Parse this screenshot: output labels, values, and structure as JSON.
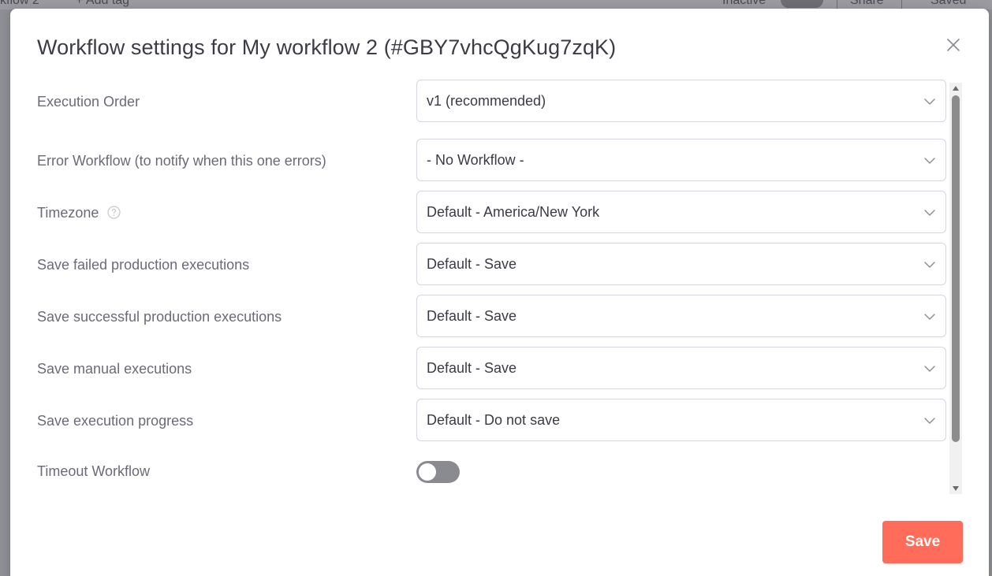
{
  "background": {
    "workflow_name_fragment": "kflow 2",
    "add_tag_label": "+ Add tag",
    "inactive_label": "Inactive",
    "share_label": "Share",
    "saved_label": "Saved"
  },
  "modal": {
    "title": "Workflow settings for My workflow 2 (#GBY7vhcQgKug7zqK)",
    "close_icon": "close-icon",
    "save_label": "Save",
    "accent_color": "#ff6d5a"
  },
  "settings": {
    "execution_order": {
      "label": "Execution Order",
      "value": "v1 (recommended)"
    },
    "error_workflow": {
      "label": "Error Workflow (to notify when this one errors)",
      "value": "- No Workflow -"
    },
    "timezone": {
      "label": "Timezone",
      "value": "Default - America/New York",
      "help_icon": "question-circle-icon"
    },
    "save_failed": {
      "label": "Save failed production executions",
      "value": "Default - Save"
    },
    "save_successful": {
      "label": "Save successful production executions",
      "value": "Default - Save"
    },
    "save_manual": {
      "label": "Save manual executions",
      "value": "Default - Save"
    },
    "save_progress": {
      "label": "Save execution progress",
      "value": "Default - Do not save"
    },
    "timeout": {
      "label": "Timeout Workflow",
      "enabled": false
    }
  }
}
